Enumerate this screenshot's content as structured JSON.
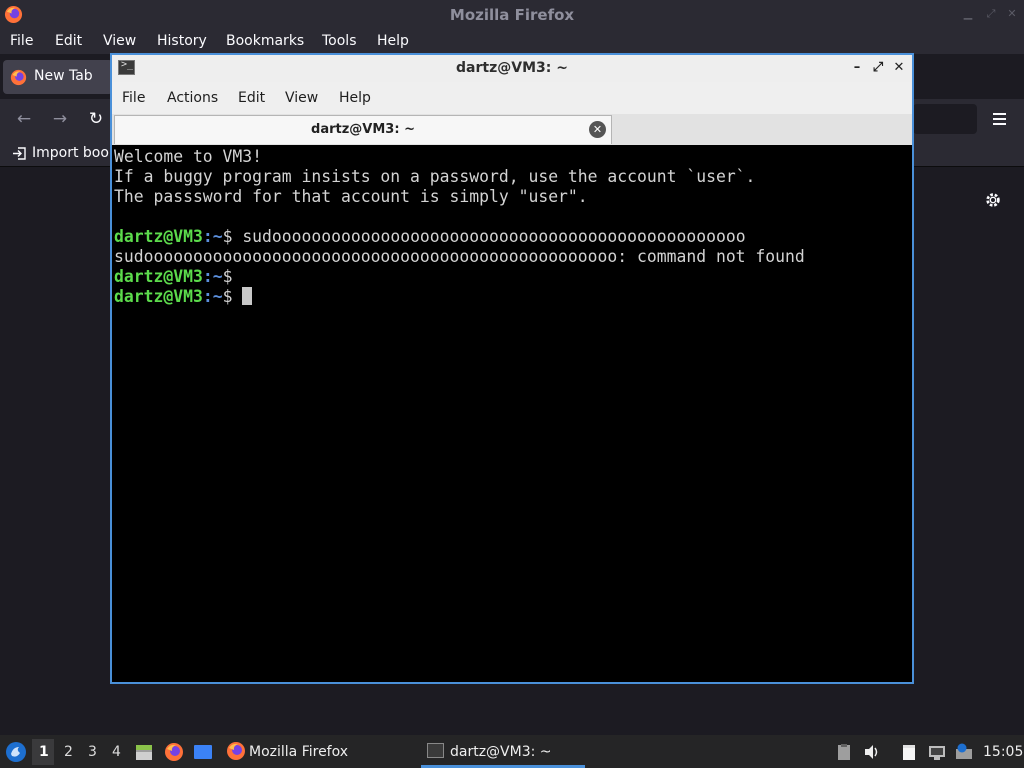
{
  "firefox": {
    "window_title": "Mozilla Firefox",
    "menu": [
      "File",
      "Edit",
      "View",
      "History",
      "Bookmarks",
      "Tools",
      "Help"
    ],
    "tab_label": "New Tab",
    "bookmarks_import_label": "Import book",
    "icons": {
      "logo": "firefox-logo-icon",
      "back": "back-arrow-icon",
      "forward": "forward-arrow-icon",
      "reload": "reload-icon",
      "menu": "hamburger-menu-icon",
      "settings": "gear-icon"
    }
  },
  "terminal": {
    "window_title": "dartz@VM3: ~",
    "menu": [
      "File",
      "Actions",
      "Edit",
      "View",
      "Help"
    ],
    "tab_label": "dartz@VM3: ~",
    "lines": {
      "l1": "Welcome to VM3!",
      "l2": "If a buggy program insists on a password, use the account `user`.",
      "l3": "The passsword for that account is simply \"user\".",
      "prompt_user": "dartz@VM3",
      "prompt_sep": ":",
      "prompt_path": "~",
      "prompt_dollar": "$ ",
      "cmd1": "sudoooooooooooooooooooooooooooooooooooooooooooooooo",
      "out1": "sudoooooooooooooooooooooooooooooooooooooooooooooooo: command not found"
    },
    "colors": {
      "user": "#5cdb4c",
      "path": "#5b8fdd",
      "text": "#d3d3d3",
      "border": "#4a90d9"
    }
  },
  "taskbar": {
    "workspaces": [
      "1",
      "2",
      "3",
      "4"
    ],
    "active_workspace": "1",
    "tasks": [
      {
        "label": "Mozilla Firefox",
        "icon": "firefox-logo-icon"
      },
      {
        "label": "dartz@VM3: ~",
        "icon": "terminal-icon"
      }
    ],
    "clock": "15:05"
  }
}
